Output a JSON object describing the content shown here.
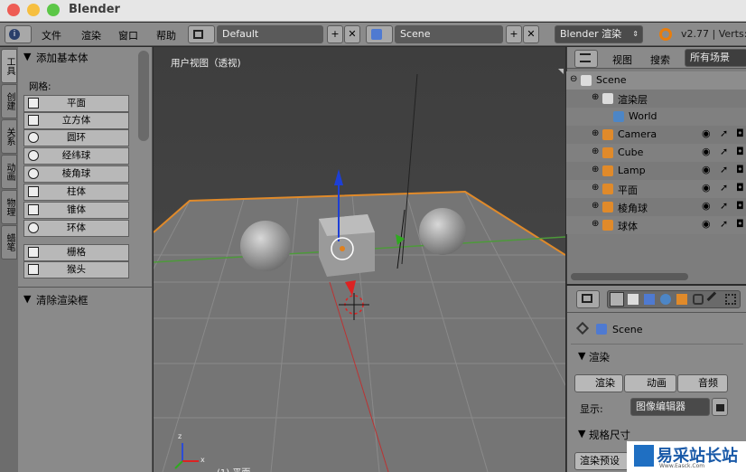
{
  "window": {
    "title": "Blender"
  },
  "infobar": {
    "menus": [
      "文件",
      "渲染",
      "窗口",
      "帮助"
    ],
    "screen": "Default",
    "scene": "Scene",
    "engine": "Blender 渲染",
    "version": "v2.77 | Verts:5"
  },
  "tabs": [
    "工具",
    "创建",
    "关系",
    "动画",
    "物理",
    "蜡笔"
  ],
  "toolshelf": {
    "panel": "添加基本体",
    "mesh_label": "网格:",
    "buttons": [
      "平面",
      "立方体",
      "圆环",
      "经纬球",
      "棱角球",
      "柱体",
      "锥体",
      "环体",
      "栅格",
      "猴头"
    ],
    "panel2": "清除渲染框"
  },
  "viewport": {
    "label": "用户视图（透视)",
    "status": "(1) 平面",
    "axis_x": "x",
    "axis_z": "z"
  },
  "outliner": {
    "header": {
      "view": "视图",
      "search": "搜索",
      "filter": "所有场景"
    },
    "rows": [
      "Scene",
      "渲染层",
      "World",
      "Camera",
      "Cube",
      "Lamp",
      "平面",
      "棱角球",
      "球体"
    ]
  },
  "properties": {
    "context": "Scene",
    "render_panel": "渲染",
    "buttons": [
      "渲染",
      "动画",
      "音频"
    ],
    "display_label": "显示:",
    "display_value": "图像编辑器",
    "dimensions_panel": "规格尺寸",
    "preset": "渲染预设"
  },
  "watermark": {
    "text": "易采站长站",
    "sub": "Www.Easck.Com"
  }
}
